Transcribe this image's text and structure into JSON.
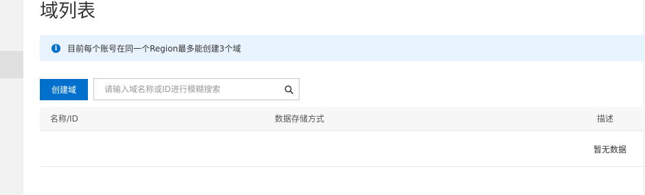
{
  "page": {
    "title": "域列表"
  },
  "notice": {
    "icon": "info-icon",
    "text": "目前每个账号在同一个Region最多能创建3个域"
  },
  "toolbar": {
    "create_label": "创建域"
  },
  "search": {
    "placeholder": "请输入域名称或ID进行模糊搜索",
    "value": "",
    "icon": "search-icon"
  },
  "table": {
    "columns": [
      "名称/ID",
      "数据存储方式",
      "描述"
    ],
    "rows": [],
    "empty_text": "暂无数据"
  },
  "colors": {
    "primary": "#0070cc",
    "notice_bg": "#e8f3fd",
    "header_bg": "#f7f7f7"
  }
}
